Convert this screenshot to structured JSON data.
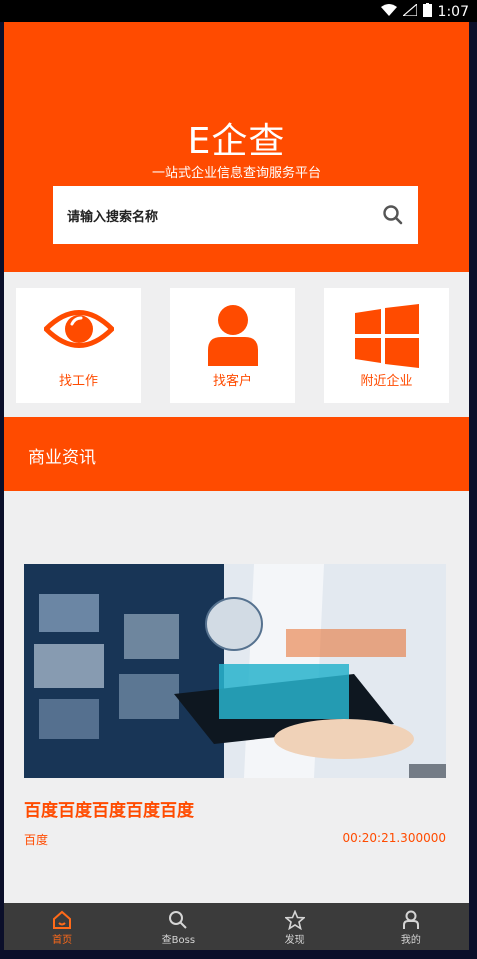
{
  "status_bar": {
    "time": "1:07"
  },
  "hero": {
    "title": "E企查",
    "subtitle": "一站式企业信息查询服务平台",
    "search_placeholder": "请输入搜索名称"
  },
  "quick_actions": [
    {
      "label": "找工作",
      "icon": "eye-icon"
    },
    {
      "label": "找客户",
      "icon": "person-icon"
    },
    {
      "label": "附近企业",
      "icon": "windows-icon"
    }
  ],
  "section": {
    "title": "商业资讯"
  },
  "news": {
    "headline": "百度百度百度百度百度",
    "source": "百度",
    "time": "00:20:21.300000"
  },
  "tabbar": [
    {
      "label": "首页",
      "icon": "home-icon",
      "active": true
    },
    {
      "label": "查Boss",
      "icon": "search-icon",
      "active": false
    },
    {
      "label": "发现",
      "icon": "star-icon",
      "active": false
    },
    {
      "label": "我的",
      "icon": "user-icon",
      "active": false
    }
  ],
  "colors": {
    "accent": "#ff4b00",
    "tabbar": "#3b3b3b",
    "background": "#efeff0"
  }
}
